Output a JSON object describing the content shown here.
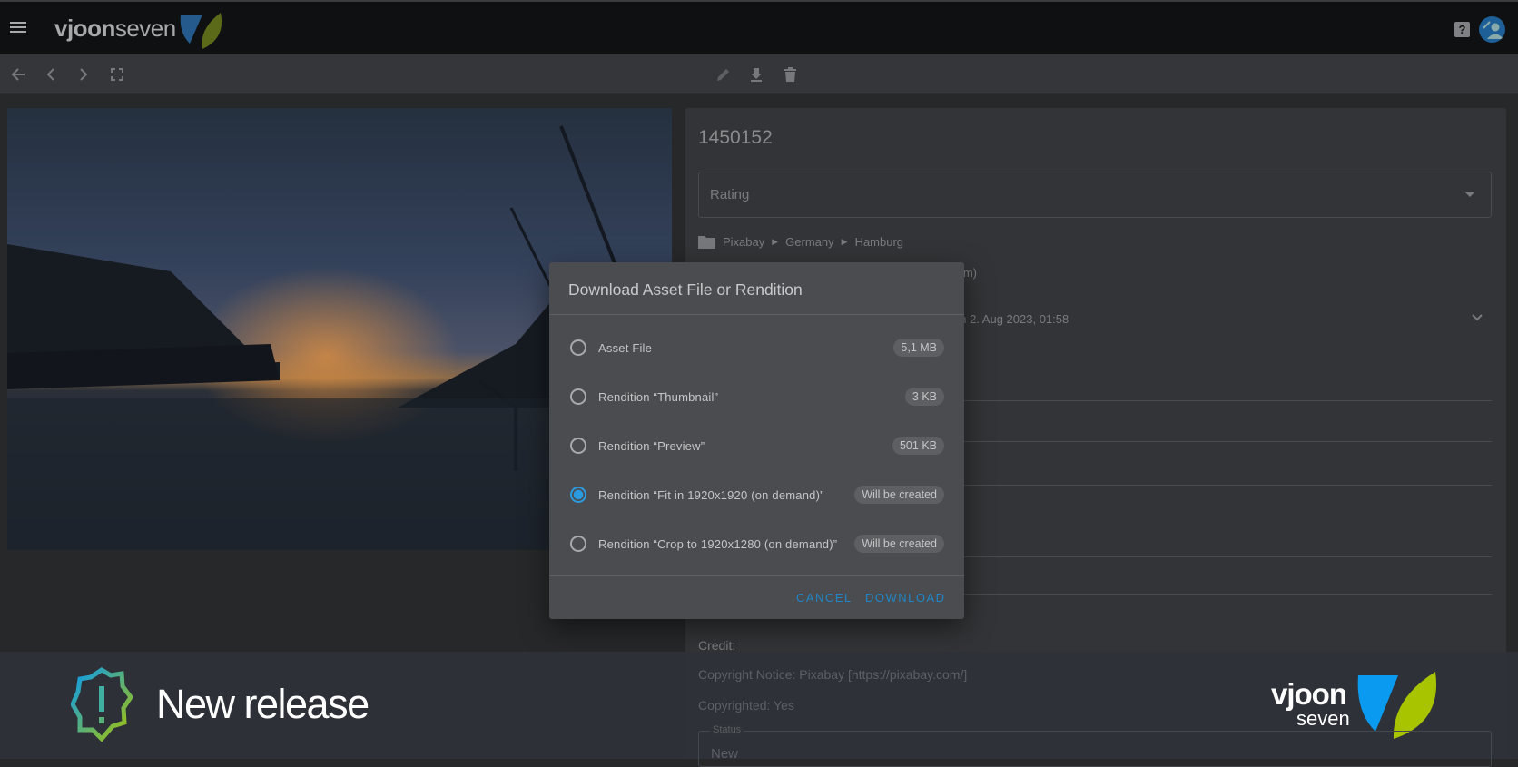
{
  "header": {
    "logo_text_bold": "vjoon",
    "logo_text_light": "seven",
    "help_label": "?"
  },
  "toolbar": {
    "icons": [
      "arrow-back-icon",
      "chevron-left-icon",
      "chevron-right-icon",
      "fullscreen-icon",
      "edit-icon",
      "download-icon",
      "delete-icon"
    ]
  },
  "panel": {
    "title": "1450152",
    "rating_label": "Rating",
    "breadcrumb": [
      "Pixabay",
      "Germany",
      "Hamburg"
    ],
    "partial_text_1": "mm)",
    "partial_text_2": "on 2. Aug 2023, 01:58",
    "credit": "Credit:",
    "copyright_notice": "Copyright Notice: Pixabay [https://pixabay.com/]",
    "copyrighted": "Copyrighted: Yes",
    "status_label": "Status",
    "status_value": "New"
  },
  "dialog": {
    "title": "Download Asset File or Rendition",
    "options": [
      {
        "label": "Asset File",
        "size": "5,1 MB",
        "selected": false
      },
      {
        "label": "Rendition “Thumbnail”",
        "size": "3 KB",
        "selected": false
      },
      {
        "label": "Rendition “Preview”",
        "size": "501 KB",
        "selected": false
      },
      {
        "label": "Rendition “Fit in 1920x1920 (on demand)”",
        "size": "Will be created",
        "selected": true
      },
      {
        "label": "Rendition “Crop to 1920x1280 (on demand)”",
        "size": "Will be created",
        "selected": false
      }
    ],
    "cancel": "CANCEL",
    "download": "DOWNLOAD"
  },
  "banner": {
    "text": "New release",
    "logo_bold": "vjoon",
    "logo_light": "seven"
  },
  "colors": {
    "accent": "#1f86c8",
    "logo_blue": "#0a9bf0",
    "logo_green": "#a8c400"
  }
}
